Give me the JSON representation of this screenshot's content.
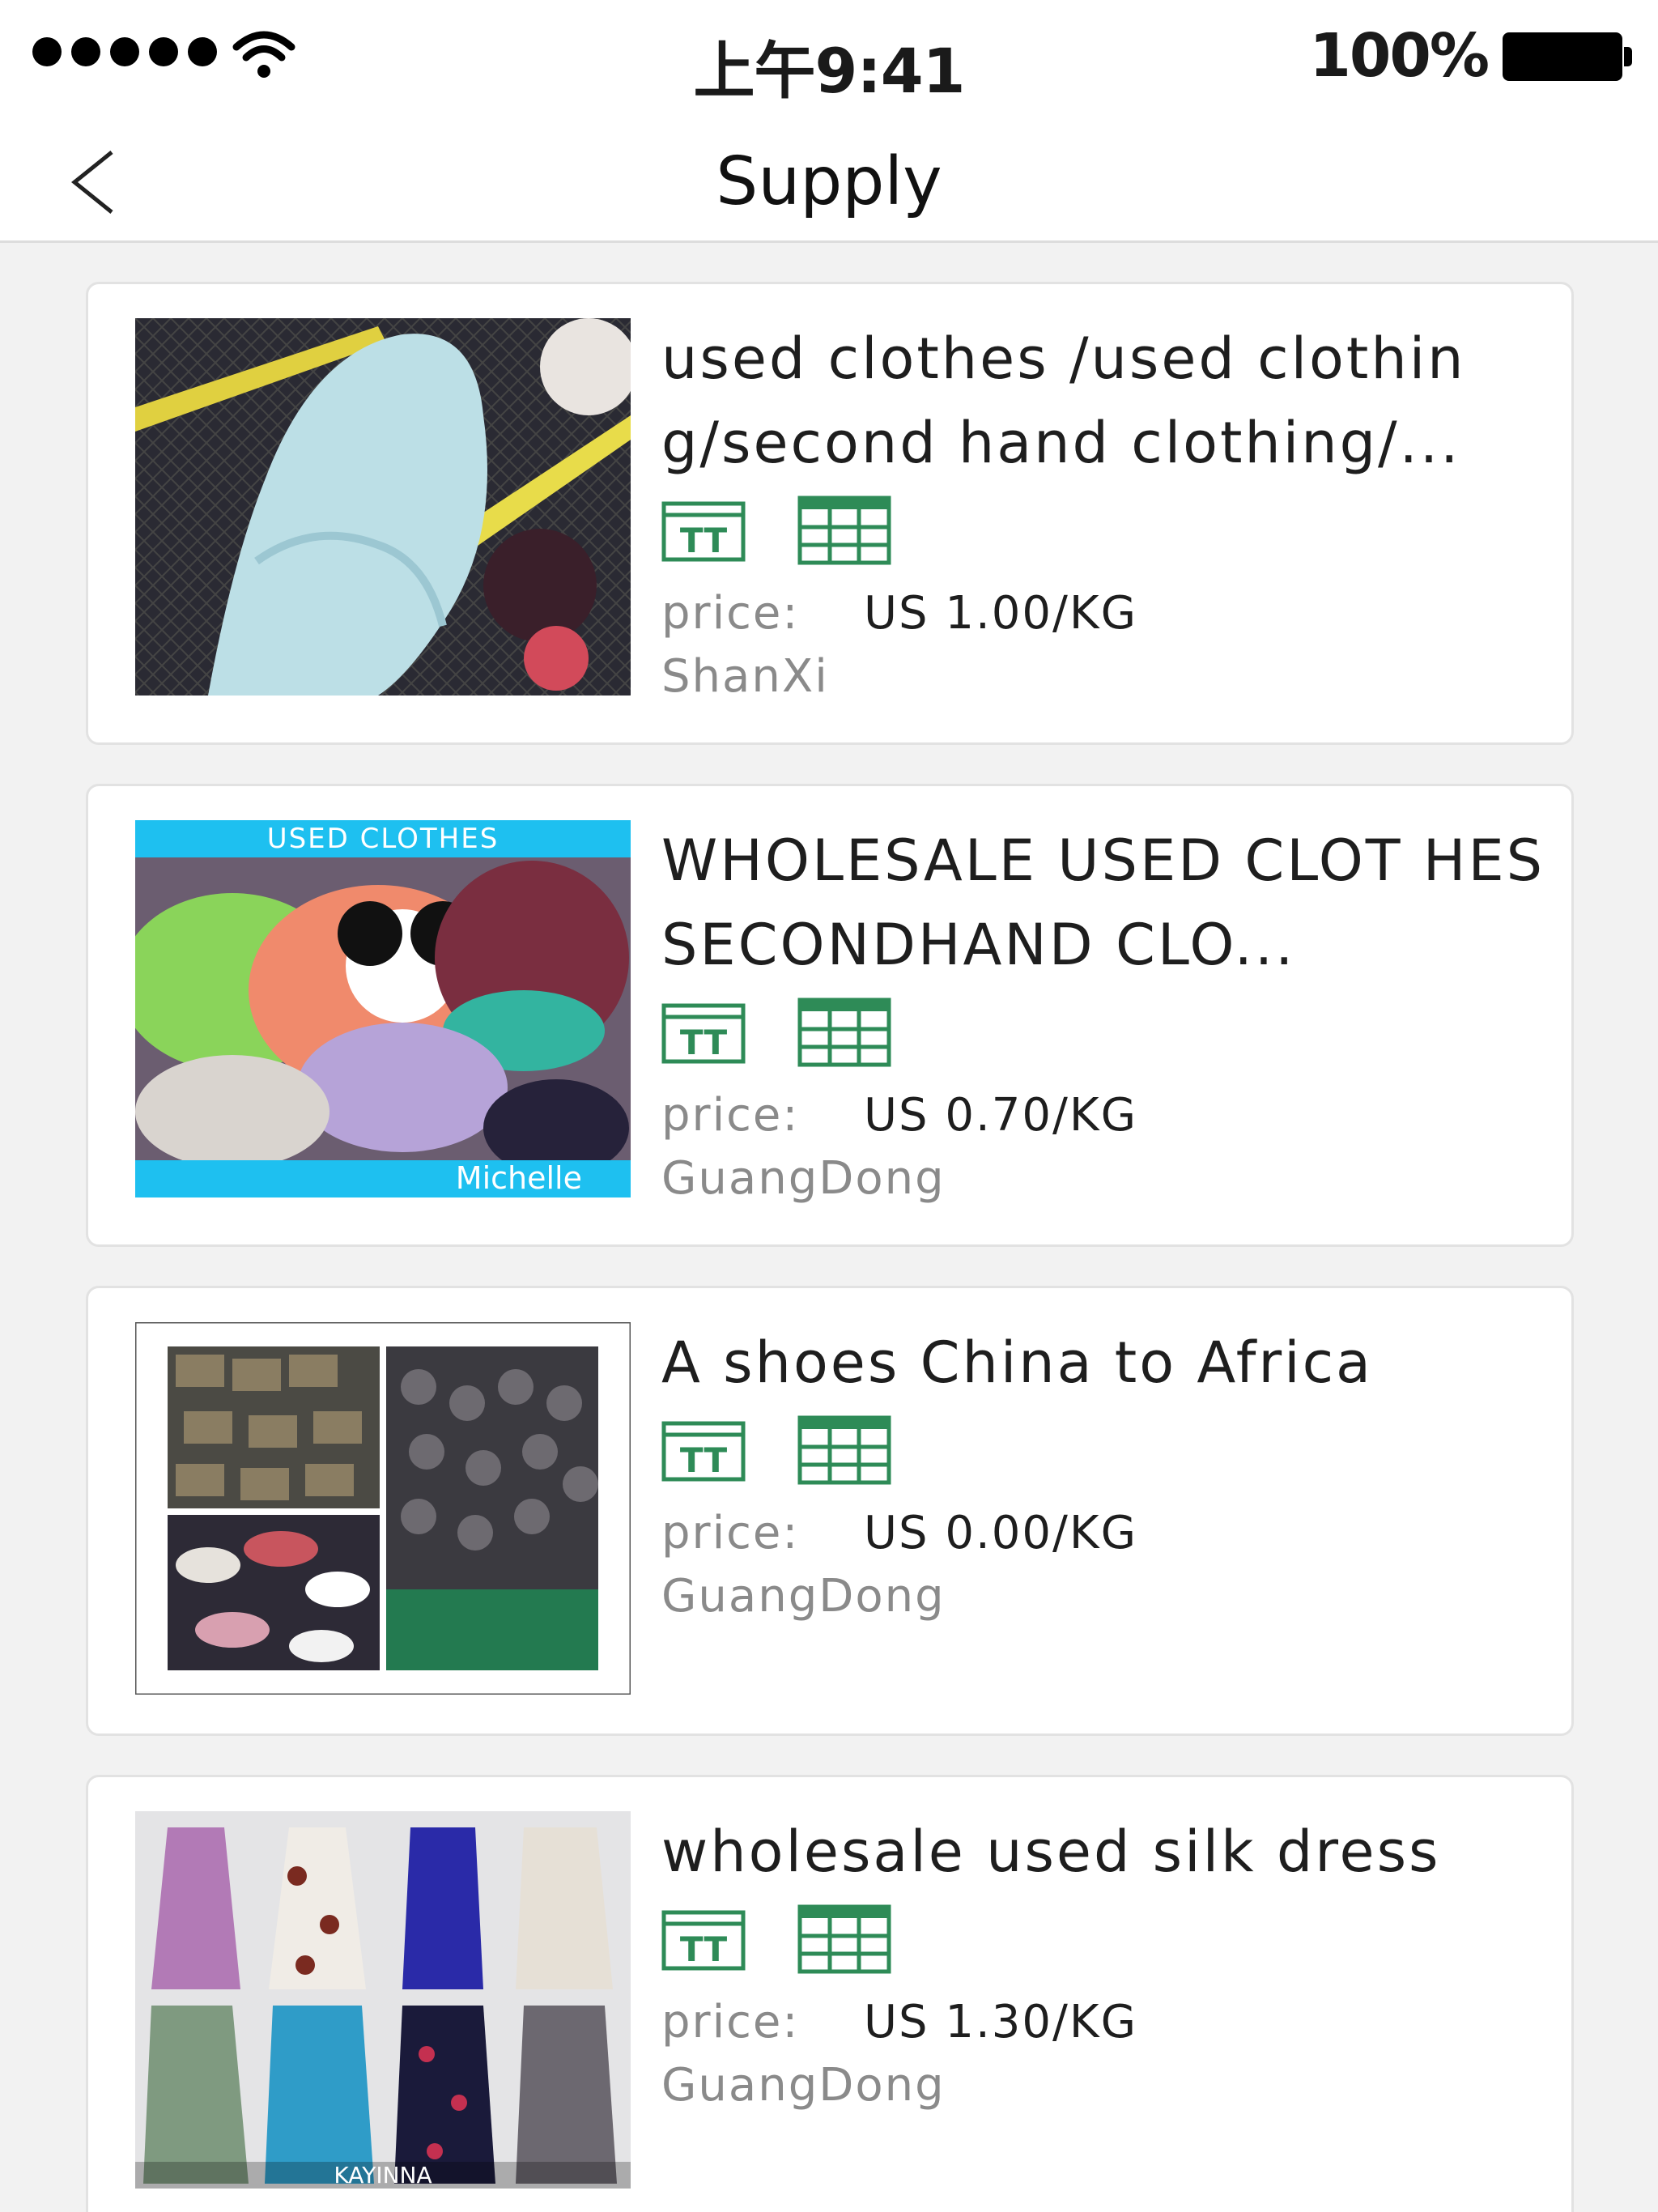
{
  "status_bar": {
    "time": "上午9:41",
    "battery_percent": "100%"
  },
  "nav": {
    "title": "Supply"
  },
  "listings": [
    {
      "title": "used clothes /used clothin g/second hand clothing/...",
      "price_label": "price:",
      "price": "US 1.00/KG",
      "location": "ShanXi"
    },
    {
      "title": "WHOLESALE USED CLOT HES SECONDHAND CLO...",
      "price_label": "price:",
      "price": "US 0.70/KG",
      "location": "GuangDong",
      "image_banner": "USED CLOTHES",
      "image_name": "Michelle"
    },
    {
      "title": "A shoes China to Africa",
      "price_label": "price:",
      "price": "US 0.00/KG",
      "location": "GuangDong"
    },
    {
      "title": "wholesale used silk dress",
      "price_label": "price:",
      "price": "US 1.30/KG",
      "location": "GuangDong",
      "image_caption": "KAYINNA"
    }
  ],
  "colors": {
    "badge_green": "#2e8b57",
    "image_banner": "#1ec0f0"
  },
  "icons": {
    "badge_1": "trade-terms-icon",
    "badge_2": "spreadsheet-icon"
  }
}
